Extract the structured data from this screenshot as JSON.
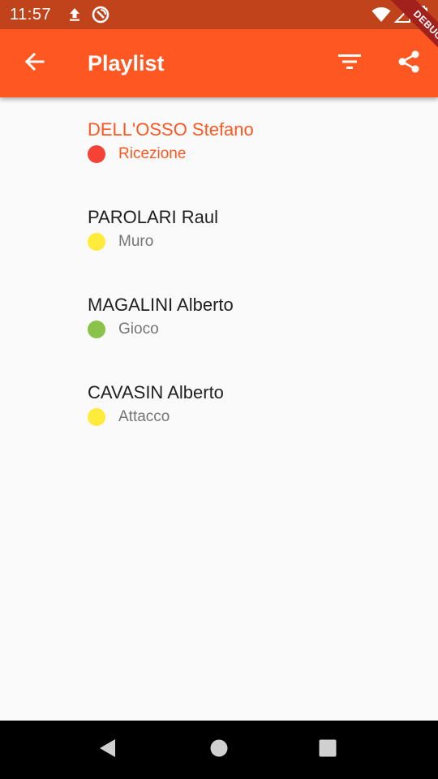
{
  "status_bar": {
    "time": "11:57",
    "icons": [
      "upload-icon",
      "sync-icon",
      "wifi-icon",
      "signal-icon",
      "battery-icon"
    ]
  },
  "app_bar": {
    "title": "Playlist",
    "back_icon": "arrow-back-icon",
    "filter_icon": "filter-list-icon",
    "share_icon": "share-icon",
    "color": "#fe5722"
  },
  "debug_banner": {
    "label": "DEBUG"
  },
  "playlist": {
    "items": [
      {
        "name": "DELL'OSSO Stefano",
        "role": "Ricezione",
        "dot_color": "#f44336",
        "selected": true
      },
      {
        "name": "PAROLARI Raul",
        "role": "Muro",
        "dot_color": "#ffeb3b",
        "selected": false
      },
      {
        "name": "MAGALINI Alberto",
        "role": "Gioco",
        "dot_color": "#8bc34a",
        "selected": false
      },
      {
        "name": "CAVASIN Alberto",
        "role": "Attacco",
        "dot_color": "#ffeb3b",
        "selected": false
      }
    ]
  },
  "nav_bar": {
    "icons": [
      "back-triangle-icon",
      "home-circle-icon",
      "recents-square-icon"
    ]
  }
}
